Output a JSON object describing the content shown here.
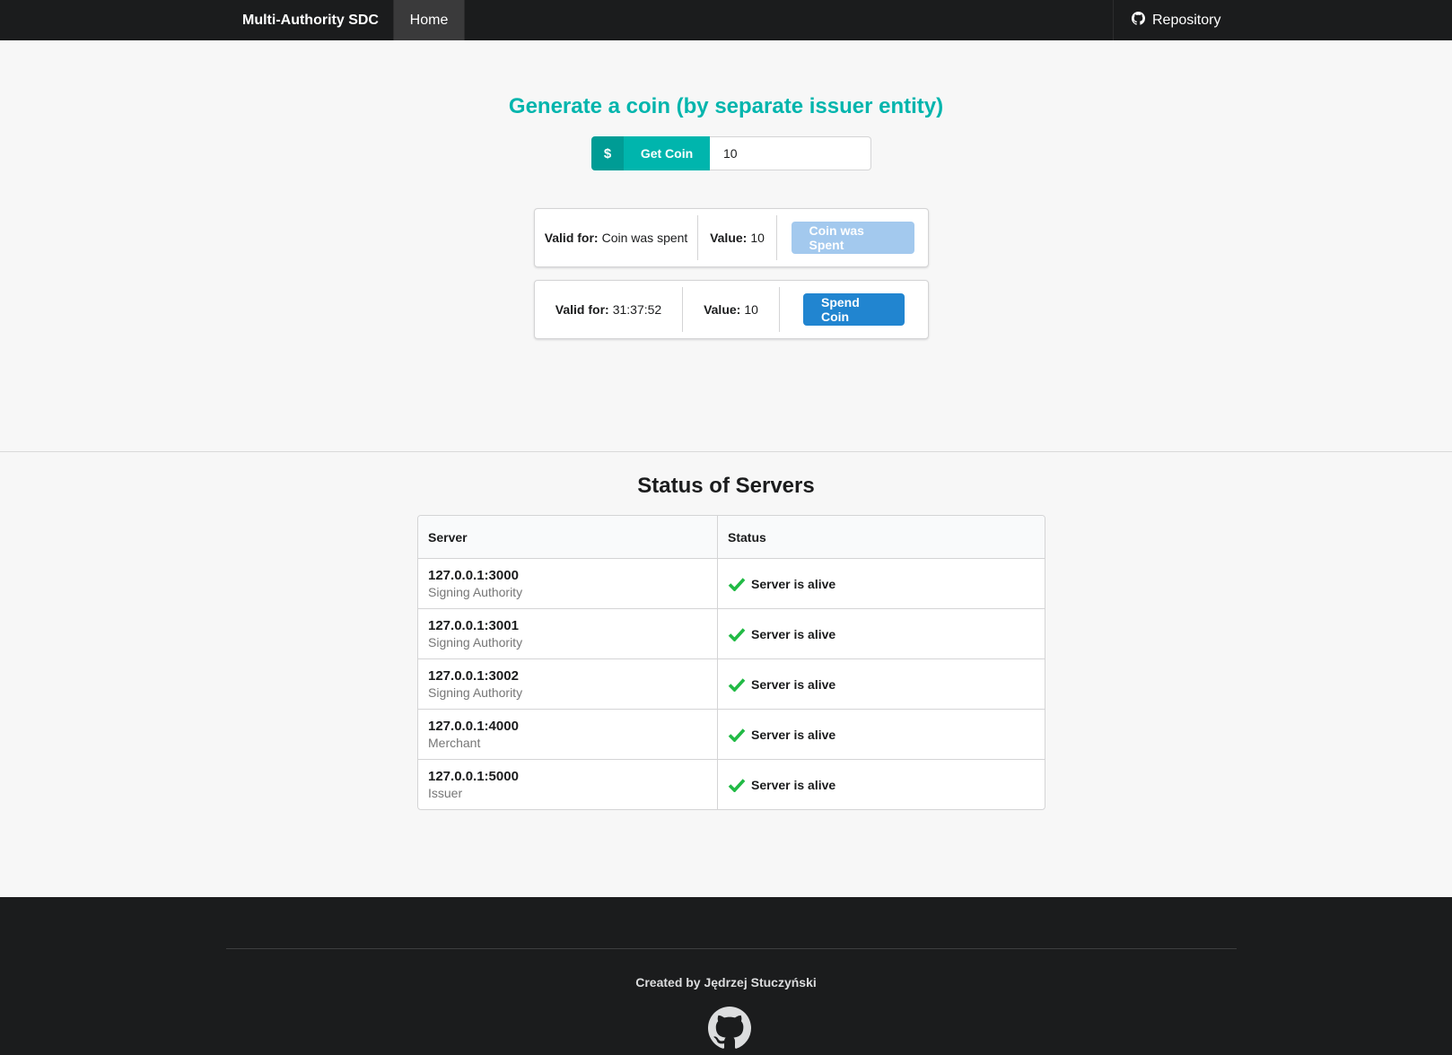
{
  "navbar": {
    "brand": "Multi-Authority SDC",
    "home_label": "Home",
    "repo_label": "Repository",
    "repo_icon": "github-icon"
  },
  "generate": {
    "title": "Generate a coin (by separate issuer entity)",
    "button_icon": "$",
    "button_label": "Get Coin",
    "amount_value": "10"
  },
  "coins": [
    {
      "valid_label": "Valid for:",
      "valid_value": "Coin was spent",
      "value_label": "Value:",
      "value": "10",
      "action_label": "Coin was Spent",
      "action_state": "disabled"
    },
    {
      "valid_label": "Valid for:",
      "valid_value": "31:37:52",
      "value_label": "Value:",
      "value": "10",
      "action_label": "Spend Coin",
      "action_state": "enabled"
    }
  ],
  "status": {
    "title": "Status of Servers",
    "headers": [
      "Server",
      "Status"
    ],
    "rows": [
      {
        "address": "127.0.0.1:3000",
        "role": "Signing Authority",
        "status": "Server is alive"
      },
      {
        "address": "127.0.0.1:3001",
        "role": "Signing Authority",
        "status": "Server is alive"
      },
      {
        "address": "127.0.0.1:3002",
        "role": "Signing Authority",
        "status": "Server is alive"
      },
      {
        "address": "127.0.0.1:4000",
        "role": "Merchant",
        "status": "Server is alive"
      },
      {
        "address": "127.0.0.1:5000",
        "role": "Issuer",
        "status": "Server is alive"
      }
    ]
  },
  "footer": {
    "credit": "Created by Jędrzej Stuczyński",
    "icon": "github-icon"
  },
  "colors": {
    "navbar_bg": "#1b1c1d",
    "teal": "#00b5ad",
    "blue": "#2185d0",
    "blue_disabled": "#a3c9ee",
    "success_green": "#21ba45"
  }
}
